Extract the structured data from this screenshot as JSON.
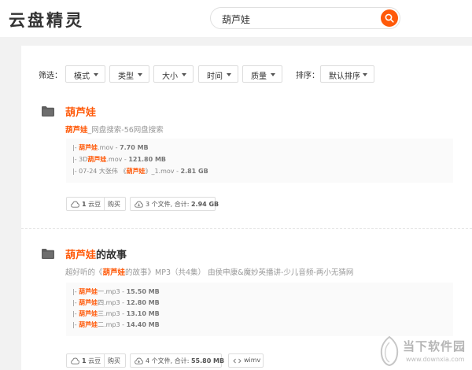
{
  "header": {
    "logo": "云盘精灵",
    "search_value": "葫芦娃"
  },
  "filters": {
    "label": "筛选：",
    "mode": "模式",
    "type": "类型",
    "size": "大小",
    "time": "时间",
    "quality": "质量",
    "sort_label": "排序：",
    "sort_value": "默认排序"
  },
  "results": [
    {
      "title_hl": "葫芦娃",
      "title_rest": "",
      "sub_hl": "葫芦娃",
      "sub_rest": "_网盘搜索-56网盘搜索",
      "files": [
        {
          "prefix": "|- ",
          "pre": "",
          "hl": "葫芦娃",
          "post": ".mov - ",
          "size": "7.70 MB"
        },
        {
          "prefix": "|- ",
          "pre": "3D",
          "hl": "葫芦娃",
          "post": ".mov - ",
          "size": "121.80 MB"
        },
        {
          "prefix": "|- ",
          "pre": "07-24 大张伟 《",
          "hl": "葫芦娃",
          "post": "》_1.mov - ",
          "size": "2.81 GB"
        }
      ],
      "points_value": "1",
      "points_unit": "云豆",
      "buy": "购买",
      "file_count_prefix": "3 个文件, 合计:",
      "total": "2.94 GB"
    },
    {
      "title_hl": "葫芦娃",
      "title_rest": "的故事",
      "sub_pre": "超好听的《",
      "sub_hl": "葫芦娃",
      "sub_rest": "的故事》MP3（共4集） 由侯申康&魔妙英播讲-少儿音频-两小无猜网",
      "files": [
        {
          "prefix": "|- ",
          "pre": "",
          "hl": "葫芦娃",
          "post": "一.mp3 - ",
          "size": "15.50 MB"
        },
        {
          "prefix": "|- ",
          "pre": "",
          "hl": "葫芦娃",
          "post": "四.mp3 - ",
          "size": "12.80 MB"
        },
        {
          "prefix": "|- ",
          "pre": "",
          "hl": "葫芦娃",
          "post": "三.mp3 - ",
          "size": "13.10 MB"
        },
        {
          "prefix": "|- ",
          "pre": "",
          "hl": "葫芦娃",
          "post": "二.mp3 - ",
          "size": "14.40 MB"
        }
      ],
      "points_value": "1",
      "points_unit": "云豆",
      "buy": "购买",
      "file_count_prefix": "4 个文件, 合计:",
      "total": "55.80 MB",
      "format": "wimv"
    }
  ],
  "watermark": {
    "cn": "当下软件园",
    "en": "www.downxia.com"
  },
  "colors": {
    "accent": "#ff5a0a",
    "background": "#f2f2f2"
  }
}
